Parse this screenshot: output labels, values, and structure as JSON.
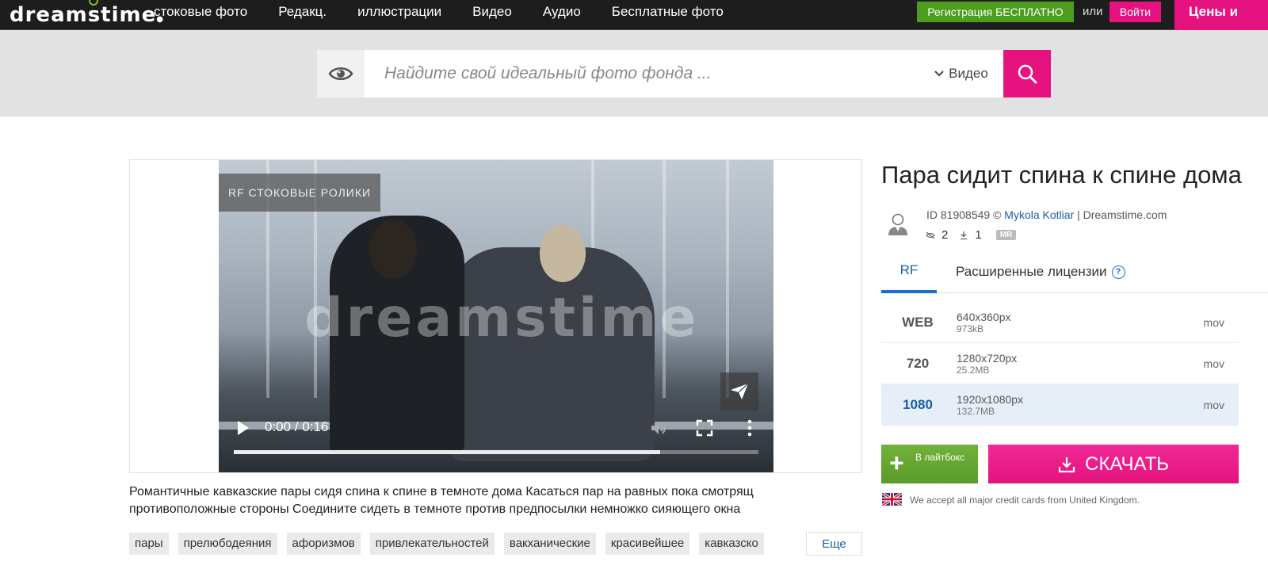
{
  "header": {
    "logo": "dreamstime",
    "nav": [
      "стоковые фото",
      "Редакц.",
      "иллюстрации",
      "Видео",
      "Аудио",
      "Бесплатные фото"
    ],
    "register_label": "Регистрация БЕСПЛАТНО",
    "or_text": "или",
    "login_label": "Войти",
    "prices_label": "Цены и"
  },
  "search": {
    "placeholder": "Найдите свой идеальный фото фонда ...",
    "type_selected": "Видео"
  },
  "player": {
    "badge": "RF СТОКОВЫЕ РОЛИКИ",
    "watermark": "dreamstime",
    "time": "0:00 / 0:16",
    "progress_fraction": 0.813
  },
  "description": "Романтичные кавказские пары сидя спина к спине в темноте дома Касаться пар на равных пока смотрящ противоположные стороны Соедините сидеть в темноте против предпосылки немножко сияющего окна",
  "tags": [
    "пары",
    "прелюбодеяния",
    "афоризмов",
    "привлекательностей",
    "вакханические",
    "красивейшее",
    "кавказско"
  ],
  "more_label": "Еще",
  "item": {
    "title": "Пара сидит спина к спине дома",
    "id_prefix": "ID 81908549 ©",
    "author": "Mykola Kotliar",
    "site_suffix": "| Dreamstime.com",
    "views": "2",
    "downloads": "1",
    "mr_badge": "MR"
  },
  "license_tabs": {
    "rf": "RF",
    "extended": "Расширенные лицензии",
    "help": "?"
  },
  "sizes": [
    {
      "name": "WEB",
      "dimensions": "640x360px",
      "filesize": "973kB",
      "format": "mov",
      "selected": false
    },
    {
      "name": "720",
      "dimensions": "1280x720px",
      "filesize": "25.2MB",
      "format": "mov",
      "selected": false
    },
    {
      "name": "1080",
      "dimensions": "1920x1080px",
      "filesize": "132.7MB",
      "format": "mov",
      "selected": true
    }
  ],
  "actions": {
    "lightbox_label": "В лайтбокс",
    "download_label": "СКАЧАТЬ"
  },
  "payment_note": "We accept all major credit cards from United Kingdom.",
  "colors": {
    "brand_pink": "#e6127f",
    "register_green": "#4d9e1e",
    "link_blue": "#1b5fa8",
    "selected_row": "#e6eef8"
  }
}
